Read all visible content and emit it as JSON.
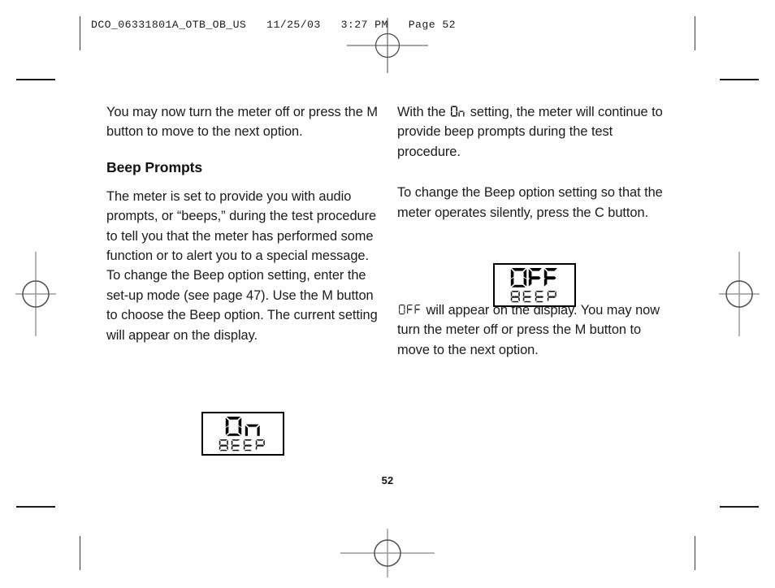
{
  "document": {
    "slug_header": "DCO_06331801A_OTB_OB_US   11/25/03   3:27 PM   Page 52",
    "folio": "52"
  },
  "left_column": {
    "intro_paragraph": "You may now turn the meter off or press the M button to move to the next option.",
    "heading": "Beep Prompts",
    "body_paragraph": "The meter is set to provide you with audio prompts, or “beeps,” during the test procedure to tell you that the meter has performed some function or to alert you to a special message. To change the Beep option setting, enter the set-up mode (see page 47). Use the M button to choose the Beep option. The current setting will appear on the display."
  },
  "right_column": {
    "paragraph_on_before": "With the ",
    "paragraph_on_lcd": "On",
    "paragraph_on_after": " setting, the meter will continue to provide beep prompts during the test procedure.",
    "paragraph_change_setting": "To change the Beep option setting so that the meter operates silently, press the C button.",
    "paragraph_off_lcd": "OFF",
    "paragraph_off_after": " will appear on the display. You may now turn the meter off or press the M button to move to the next option."
  },
  "lcd_display_on": {
    "main_value": "On",
    "label": "BEEP"
  },
  "lcd_display_off": {
    "main_value": "OFF",
    "label": "BEEP"
  },
  "colors": {
    "text": "#1b1b1b",
    "lcd_segment": "#000000",
    "lcd_border": "#000000",
    "mark": "#1a1a1a",
    "registration": "#8a8a8a",
    "page_background": "#ffffff"
  },
  "printer_marks": {
    "crop_marks": 4,
    "registration_marks": 4
  }
}
